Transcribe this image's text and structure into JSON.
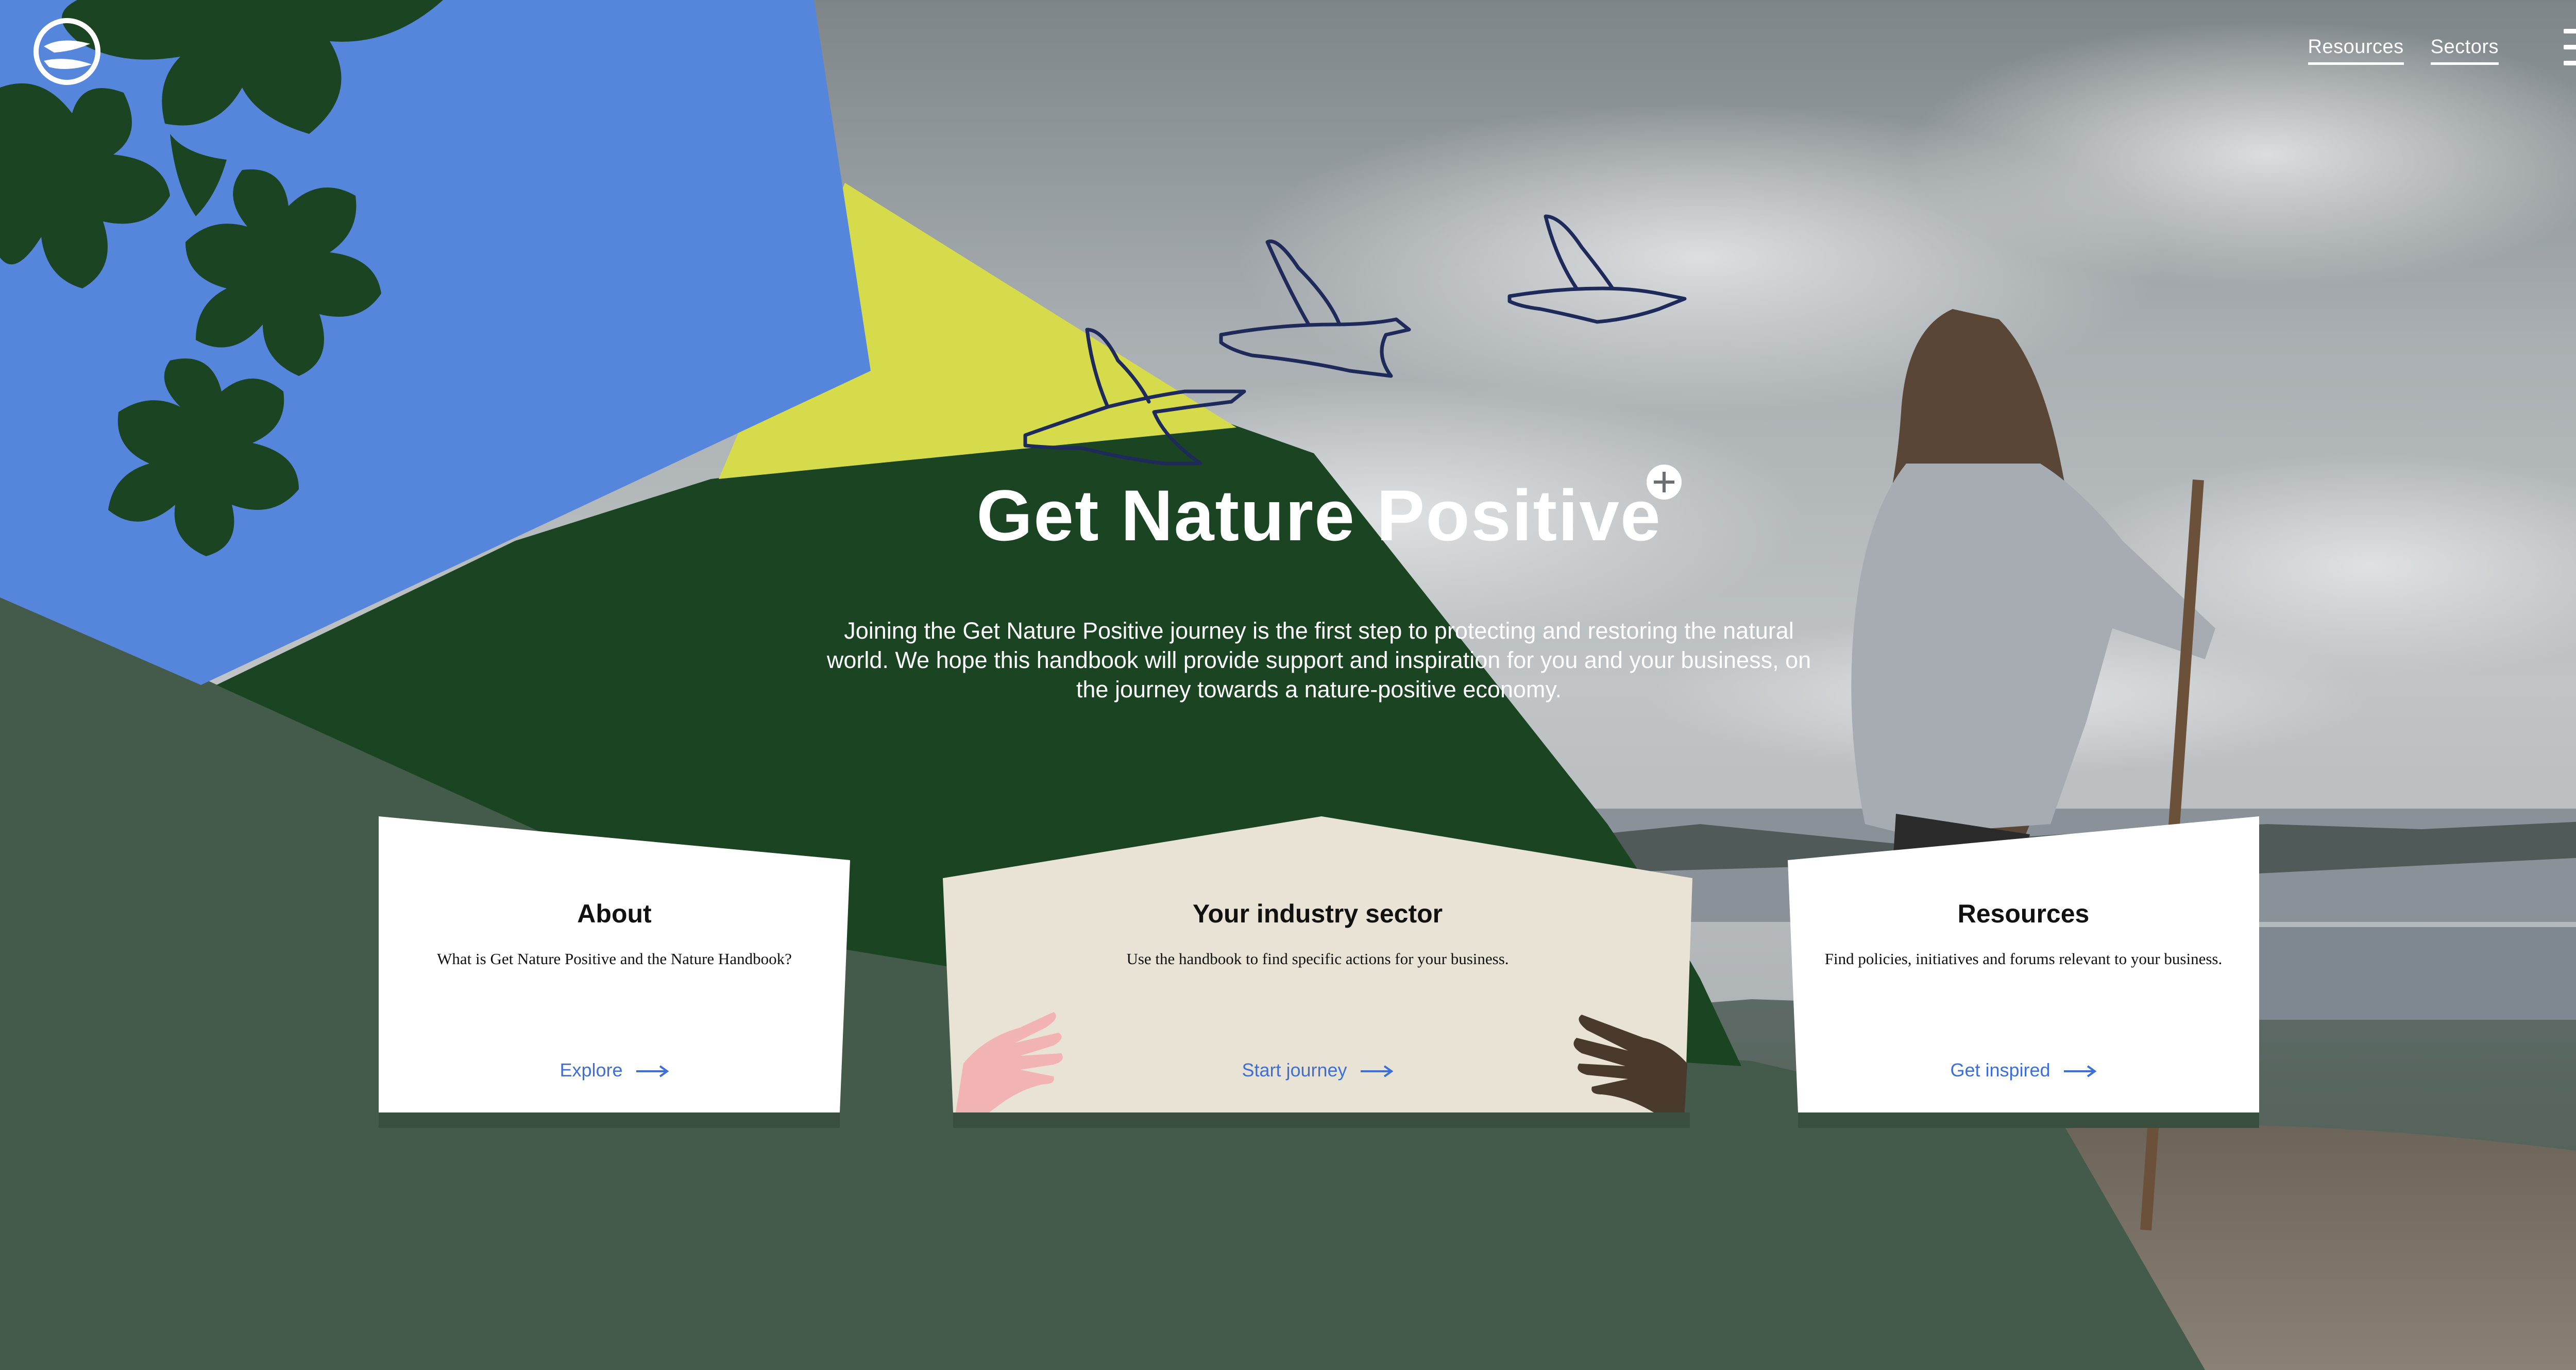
{
  "header": {
    "logo_icon": "hands-globe-icon",
    "nav": [
      {
        "label": "Resources"
      },
      {
        "label": "Sectors"
      }
    ],
    "menu_icon": "hamburger-menu-icon"
  },
  "hero": {
    "title": "Get Nature Positive",
    "title_icon": "plus-circle-icon",
    "intro": "Joining the Get Nature Positive journey is the first step to protecting and restoring the natural world. We hope this handbook will provide support and inspiration for you and your business, on the journey towards a nature-positive economy."
  },
  "cards": [
    {
      "title": "About",
      "text": "What is Get Nature Positive and the Nature Handbook?",
      "cta": "Explore",
      "cta_icon": "arrow-right-icon"
    },
    {
      "title": "Your industry sector",
      "text": "Use the handbook to find specific actions for your business.",
      "cta": "Start journey",
      "cta_icon": "arrow-right-icon"
    },
    {
      "title": "Resources",
      "text": "Find policies, initiatives and forums relevant to your business.",
      "cta": "Get inspired",
      "cta_icon": "arrow-right-icon"
    }
  ],
  "colors": {
    "accent_blue": "#3d6fd6",
    "dark_green": "#1b4522",
    "muted_green": "#445b4b",
    "sky_blue": "#5686db",
    "lime": "#d6db4c",
    "card_beige": "#e9e3d6",
    "bird_outline": "#1e2a5a"
  }
}
